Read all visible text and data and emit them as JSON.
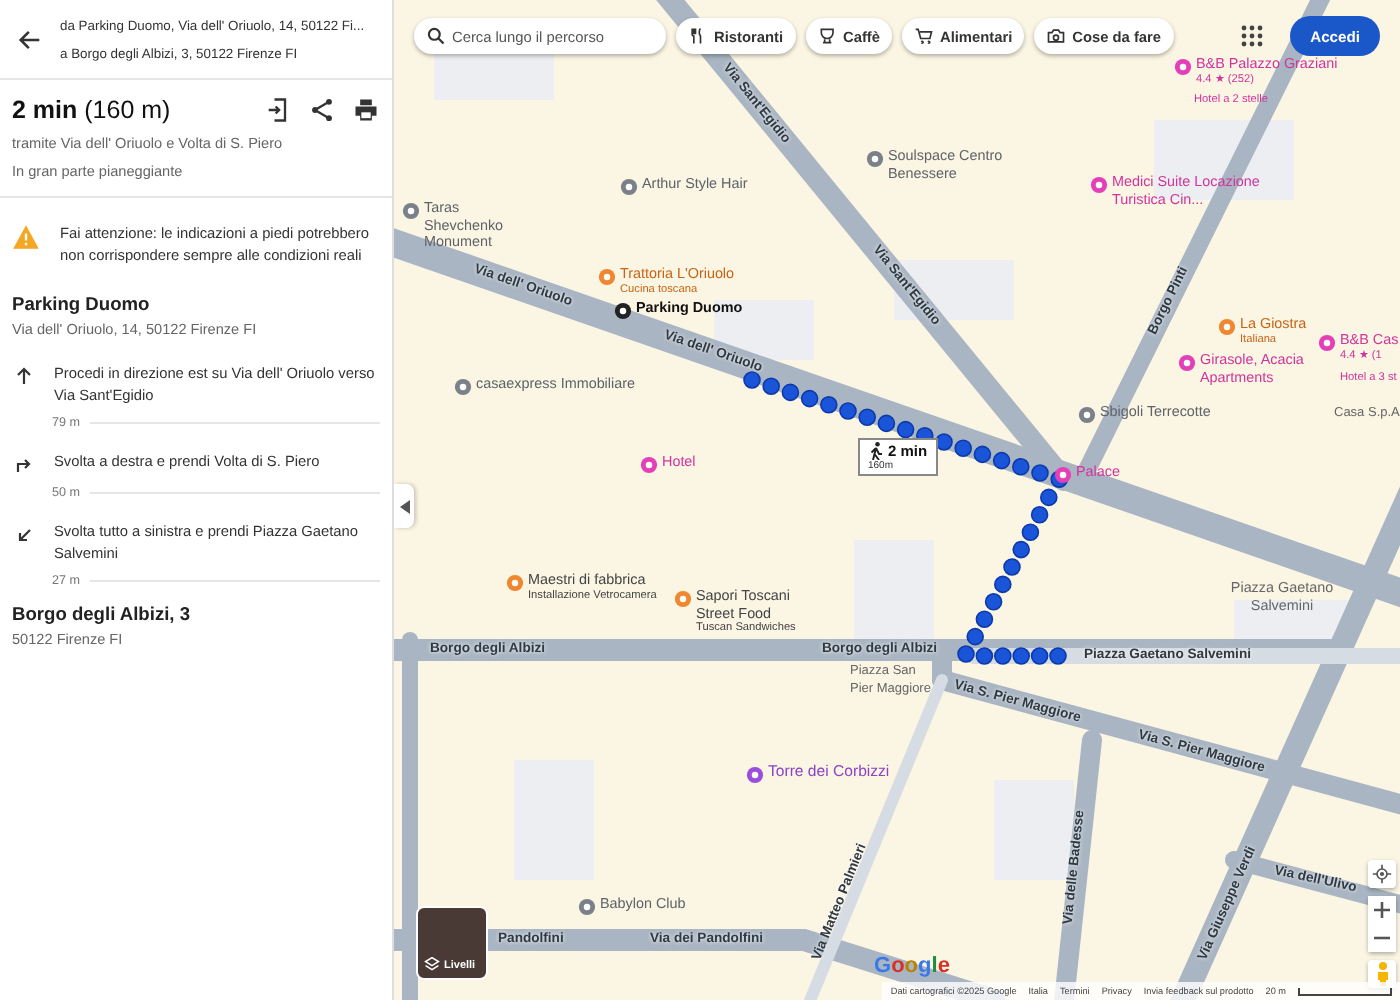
{
  "route": {
    "from": "da Parking Duomo, Via dell' Oriuolo, 14, 50122 Fi...",
    "to": "a Borgo degli Albizi, 3, 50122 Firenze FI"
  },
  "summary": {
    "duration": "2 min",
    "distance": "(160 m)",
    "via": "tramite Via dell' Oriuolo e Volta di S. Piero",
    "terrain": "In gran parte pianeggiante"
  },
  "warning": "Fai attenzione: le indicazioni a piedi potrebbero non corrispondere sempre alle condizioni reali",
  "start": {
    "name": "Parking Duomo",
    "address": "Via dell' Oriuolo, 14, 50122 Firenze FI"
  },
  "steps": [
    {
      "kind": "straight",
      "text": "Procedi in direzione est su Via dell' Oriuolo verso Via Sant'Egidio",
      "distance": "79 m"
    },
    {
      "kind": "right",
      "text": "Svolta a destra e prendi Volta di S. Piero",
      "distance": "50 m"
    },
    {
      "kind": "sharp_left",
      "text": "Svolta tutto a sinistra e prendi Piazza Gaetano Salvemini",
      "distance": "27 m"
    }
  ],
  "end": {
    "name": "Borgo degli Albizi, 3",
    "address": "50122 Firenze FI"
  },
  "map": {
    "search_placeholder": "Cerca lungo il percorso",
    "chips": [
      {
        "label": "Ristoranti",
        "kind": "restaurant"
      },
      {
        "label": "Caffè",
        "kind": "cafe"
      },
      {
        "label": "Alimentari",
        "kind": "grocery"
      },
      {
        "label": "Cose da fare",
        "kind": "camera"
      }
    ],
    "login": "Accedi",
    "labels": [
      {
        "text": "B&B Palazzo Graziani",
        "kind": "hotel",
        "sub": "4.4 ★ (252)"
      },
      {
        "text": "Hotel a 2 stelle",
        "kind": "hotel_small"
      },
      {
        "text": "Arthur Style Hair",
        "kind": "poi"
      },
      {
        "text": "Soulspace Centro Benessere",
        "kind": "poi"
      },
      {
        "text": "Medici Suite Locazione Turistica Cin...",
        "kind": "hotel"
      },
      {
        "text": "Taras Shevchenko Monument",
        "kind": "poi"
      },
      {
        "text": "Trattoria L'Oriuolo",
        "kind": "food",
        "sub": "Cucina toscana"
      },
      {
        "text": "Via dell' Oriuolo",
        "kind": "street"
      },
      {
        "text": "Via Sant'Egidio",
        "kind": "street"
      },
      {
        "text": "Via Sant'Egidio",
        "kind": "street"
      },
      {
        "text": "Borgo Pinti",
        "kind": "street"
      },
      {
        "text": "La Giostra",
        "kind": "food",
        "sub": "Italiana"
      },
      {
        "text": "B&B Cas",
        "kind": "hotel",
        "sub": "4.4 ★ (1"
      },
      {
        "text": "Hotel a 3 st",
        "kind": "hotel_small"
      },
      {
        "text": "Parking Duomo",
        "kind": "parking"
      },
      {
        "text": "casaexpress Immobiliare",
        "kind": "poi"
      },
      {
        "text": "Via dell' Oriuolo",
        "kind": "street"
      },
      {
        "text": "Girasole, Acacia Apartments",
        "kind": "hotel"
      },
      {
        "text": "Casa S.p.A",
        "kind": "plain"
      },
      {
        "text": "Sbigoli Terrecotte",
        "kind": "poi"
      },
      {
        "text": "Hotel",
        "kind": "hotel"
      },
      {
        "text": "Palace",
        "kind": "hotel"
      },
      {
        "text": "Maestri di fabbrica",
        "kind": "food_sq",
        "sub": "Installazione Vetrocamera"
      },
      {
        "text": "Piazza Gaetano Salvemini",
        "kind": "area"
      },
      {
        "text": "Borgo degli Albizi",
        "kind": "street"
      },
      {
        "text": "Sapori Toscani Street Food",
        "kind": "food_sq",
        "sub": "Tuscan Sandwiches"
      },
      {
        "text": "Borgo degli Albizi",
        "kind": "street"
      },
      {
        "text": "Piazza San Pier Maggiore",
        "kind": "plain"
      },
      {
        "text": "Piazza Gaetano Salvemini",
        "kind": "street"
      },
      {
        "text": "Via S. Pier Maggiore",
        "kind": "street"
      },
      {
        "text": "Via S. Pier Maggiore",
        "kind": "street"
      },
      {
        "text": "Torre dei Corbizzi",
        "kind": "tourist"
      },
      {
        "text": "Via Matteo Palmieri",
        "kind": "street"
      },
      {
        "text": "Via delle Badesse",
        "kind": "street"
      },
      {
        "text": "Via dell'Ulivo",
        "kind": "street"
      },
      {
        "text": "Via Giuseppe Verdi",
        "kind": "street"
      },
      {
        "text": "Babylon Club",
        "kind": "poi"
      },
      {
        "text": "Pandolfini",
        "kind": "street"
      },
      {
        "text": "Via dei Pandolfini",
        "kind": "street"
      }
    ],
    "route_badge": {
      "time": "2 min",
      "distance": "160m"
    },
    "layers": "Livelli",
    "footer": [
      "Dati cartografici ©2025 Google",
      "Italia",
      "Termini",
      "Privacy",
      "Invia feedback sul prodotto",
      "20 m"
    ],
    "logo": "Google"
  }
}
